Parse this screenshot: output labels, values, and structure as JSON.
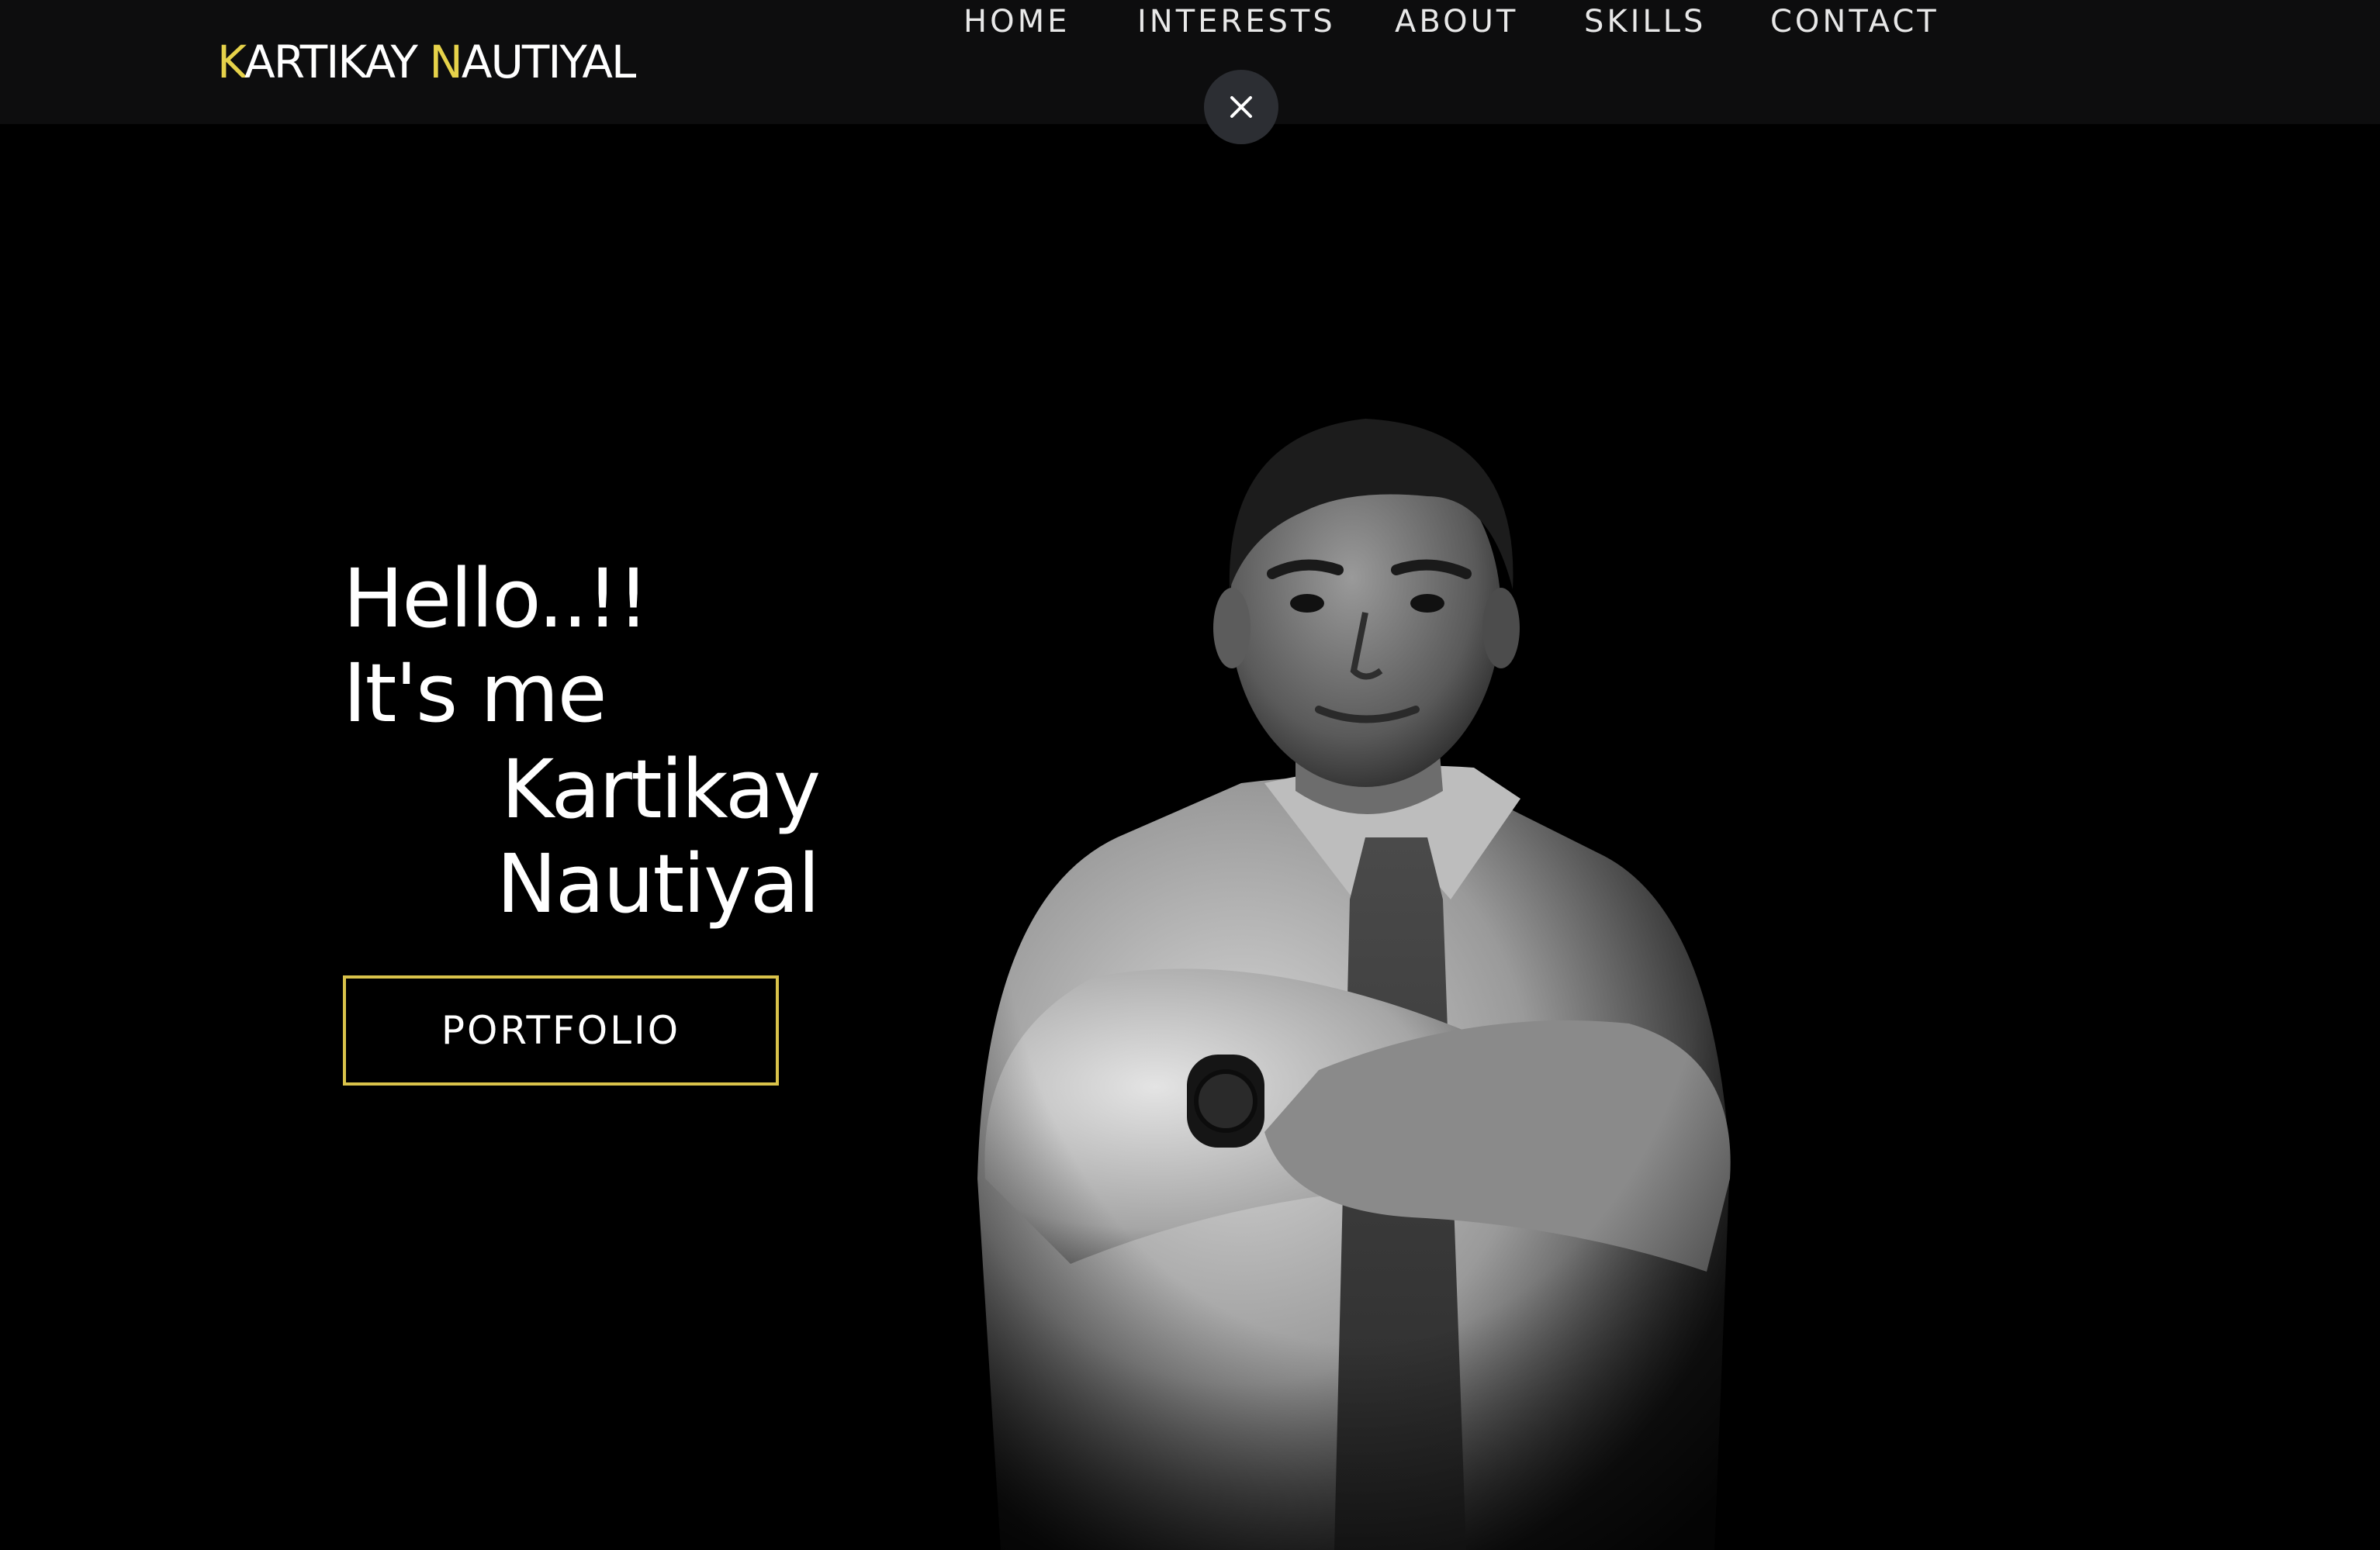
{
  "header": {
    "logo": {
      "first_initial": "K",
      "first_rest": "ARTIKAY ",
      "last_initial": "N",
      "last_rest": "AUTIYAL"
    },
    "nav": [
      {
        "label": "HOME"
      },
      {
        "label": "INTERESTS"
      },
      {
        "label": "ABOUT"
      },
      {
        "label": "SKILLS"
      },
      {
        "label": "CONTACT"
      }
    ],
    "close_icon": "close-icon"
  },
  "hero": {
    "line1": "Hello..!!",
    "line2": "It's me",
    "line3": "Kartikay",
    "line4": "Nautiyal",
    "button_label": "PORTFOLIO"
  },
  "colors": {
    "background": "#000000",
    "header_background": "#0d0d0e",
    "accent": "#e6d24a",
    "button_border": "#d9c24a",
    "text": "#ffffff"
  }
}
